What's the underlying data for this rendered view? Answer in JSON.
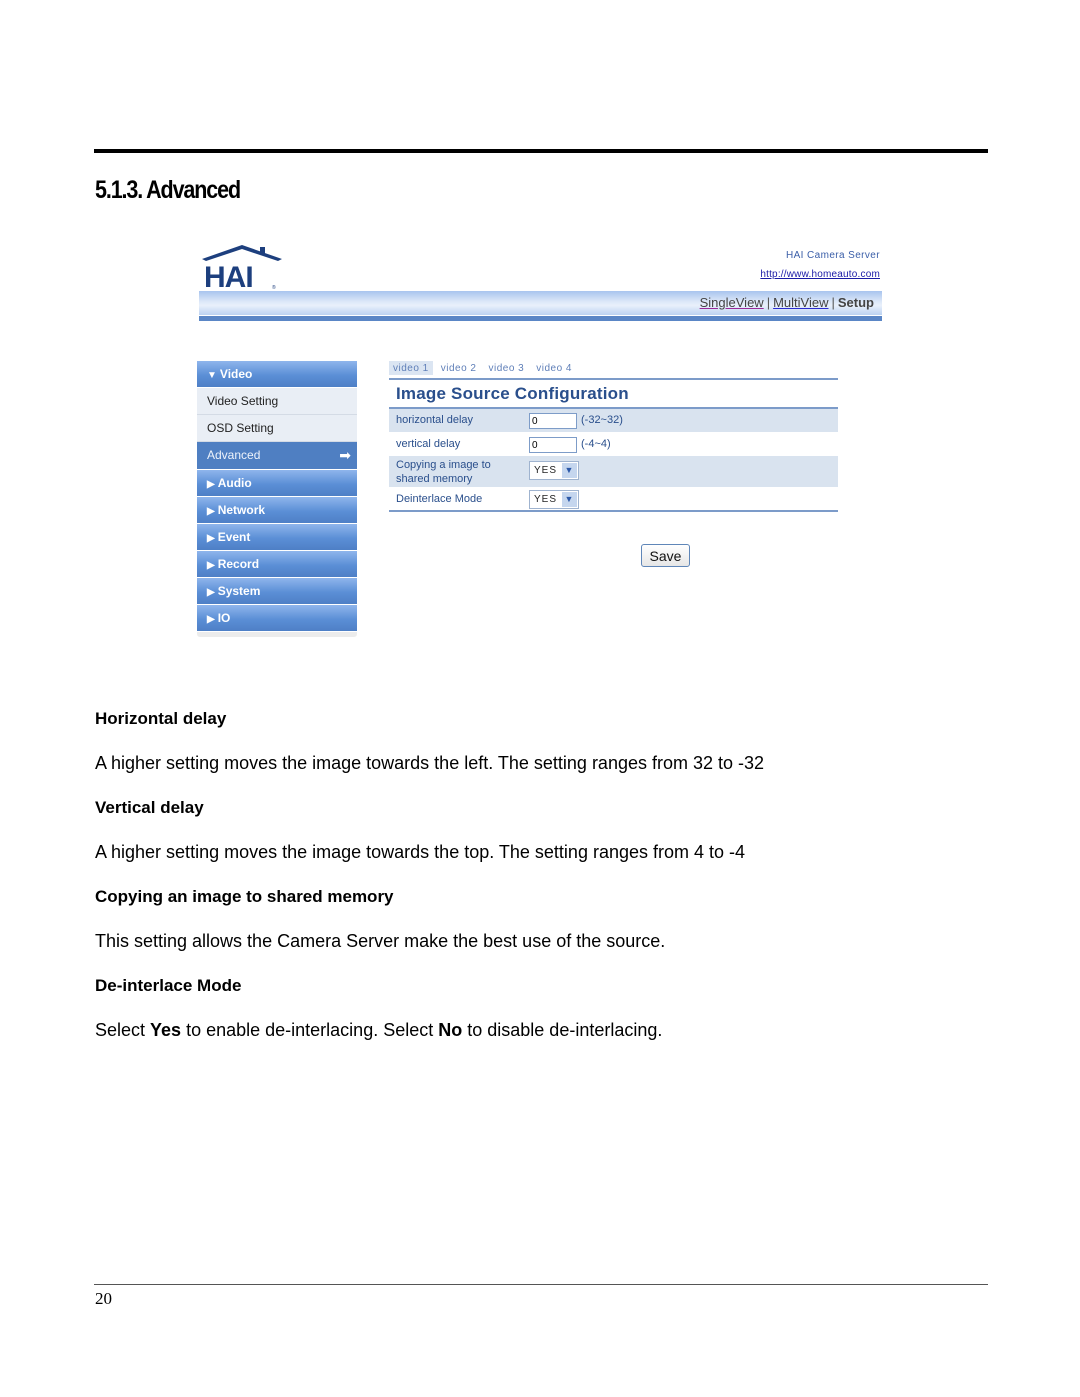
{
  "section": {
    "title": "5.1.3. Advanced"
  },
  "ui": {
    "logo_text": "HAI",
    "server_name": "HAI Camera Server",
    "server_url": "http://www.homeauto.com",
    "nav": {
      "single_view": "SingleView",
      "multi_view": "MultiView",
      "setup": "Setup",
      "separator": "|"
    },
    "sidebar": {
      "video_header": "Video",
      "video_sub": [
        "Video Setting",
        "OSD Setting"
      ],
      "active_item": "Advanced",
      "items": [
        "Audio",
        "Network",
        "Event",
        "Record",
        "System",
        "IO"
      ]
    },
    "tabs": [
      "video 1",
      "video 2",
      "video 3",
      "video 4"
    ],
    "active_tab": "video 1",
    "config_title": "Image Source Configuration",
    "rows": {
      "horizontal_delay": {
        "label": "horizontal delay",
        "value": "0",
        "hint": "(-32~32)"
      },
      "vertical_delay": {
        "label": "vertical delay",
        "value": "0",
        "hint": "(-4~4)"
      },
      "copy_image": {
        "label_line1": "Copying a image to",
        "label_line2": "shared memory",
        "value": "YES"
      },
      "deinterlace": {
        "label": "Deinterlace Mode",
        "value": "YES"
      }
    },
    "save_label": "Save"
  },
  "doc": {
    "h1": "Horizontal delay",
    "p1": "A higher setting moves the image towards the left.  The setting ranges from 32 to -32",
    "h2": "Vertical delay",
    "p2": "A higher setting moves the image towards the top.  The setting ranges from 4 to -4",
    "h3": "Copying an image to shared memory",
    "p3": "This setting allows the Camera Server make the best use of the source.",
    "h4": "De-interlace Mode",
    "p4_a": "Select ",
    "p4_yes": "Yes",
    "p4_b": " to enable de-interlacing.  Select ",
    "p4_no": "No",
    "p4_c": " to disable de-interlacing."
  },
  "page_number": "20"
}
